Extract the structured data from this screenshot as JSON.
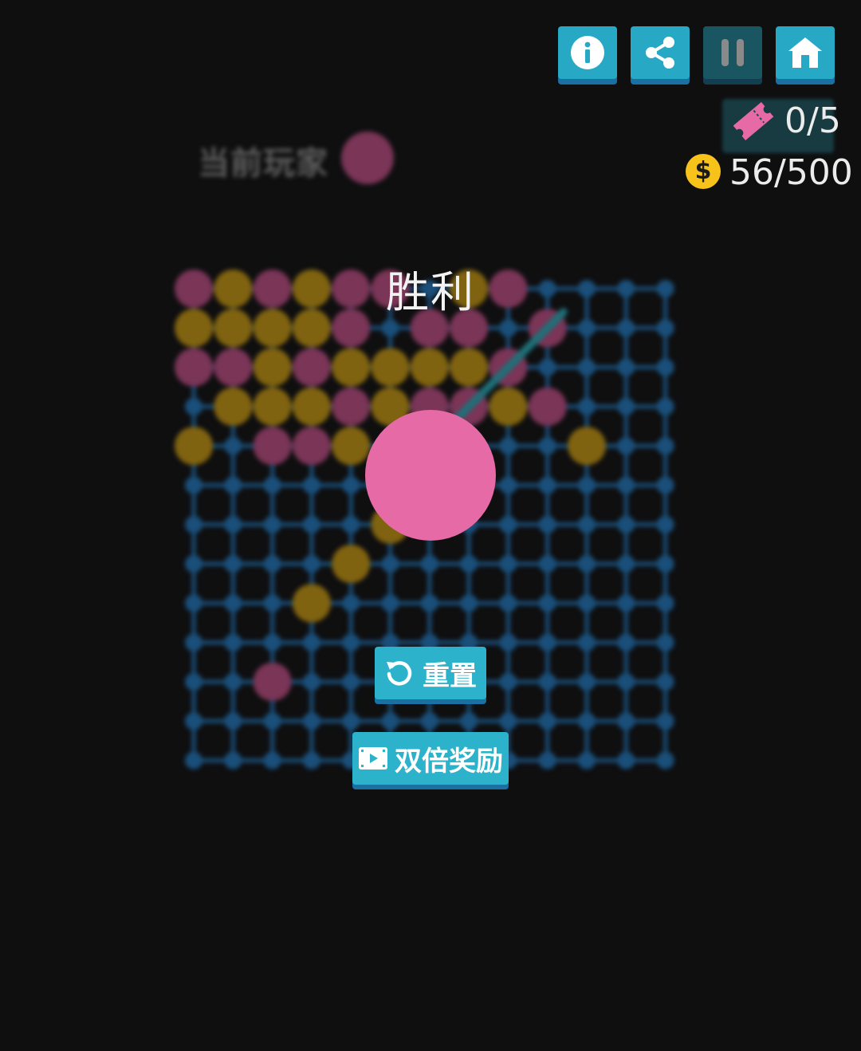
{
  "header": {
    "buttons": [
      {
        "name": "info-button",
        "icon": "info-icon"
      },
      {
        "name": "share-button",
        "icon": "share-icon"
      },
      {
        "name": "pause-button",
        "icon": "pause-icon"
      },
      {
        "name": "home-button",
        "icon": "home-icon"
      }
    ],
    "tickets": {
      "icon": "ticket-icon",
      "value": "0/5",
      "color": "#e66aa6"
    },
    "coins": {
      "icon": "coin-icon",
      "symbol": "$",
      "value": "56/500",
      "color": "#f7c21a"
    }
  },
  "status": {
    "current_player_label": "当前玩家",
    "current_player_color": "#7a3557"
  },
  "board": {
    "size": 13,
    "colors": {
      "grid": "#1a4f7a",
      "pink": "#7a3557",
      "gold": "#806310",
      "win_line": "#1f6f78"
    },
    "pink_stones": [
      [
        0,
        0
      ],
      [
        0,
        2
      ],
      [
        0,
        4
      ],
      [
        0,
        5
      ],
      [
        0,
        8
      ],
      [
        1,
        4
      ],
      [
        1,
        6
      ],
      [
        1,
        7
      ],
      [
        1,
        9
      ],
      [
        2,
        0
      ],
      [
        2,
        1
      ],
      [
        2,
        3
      ],
      [
        2,
        8
      ],
      [
        3,
        4
      ],
      [
        3,
        6
      ],
      [
        3,
        7
      ],
      [
        3,
        9
      ],
      [
        4,
        2
      ],
      [
        4,
        3
      ],
      [
        10,
        2
      ]
    ],
    "gold_stones": [
      [
        0,
        1
      ],
      [
        0,
        3
      ],
      [
        0,
        7
      ],
      [
        1,
        0
      ],
      [
        1,
        1
      ],
      [
        1,
        2
      ],
      [
        1,
        3
      ],
      [
        2,
        2
      ],
      [
        2,
        4
      ],
      [
        2,
        5
      ],
      [
        2,
        6
      ],
      [
        2,
        7
      ],
      [
        3,
        1
      ],
      [
        3,
        2
      ],
      [
        3,
        3
      ],
      [
        3,
        5
      ],
      [
        3,
        8
      ],
      [
        4,
        0
      ],
      [
        4,
        4
      ],
      [
        4,
        10
      ],
      [
        6,
        5
      ],
      [
        7,
        4
      ],
      [
        8,
        3
      ]
    ],
    "win_line": [
      [
        1,
        9
      ],
      [
        3,
        7
      ]
    ]
  },
  "result": {
    "title": "胜利",
    "winner_color": "#e66aa6"
  },
  "buttons": {
    "reset": {
      "label": "重置",
      "icon": "reset-icon"
    },
    "double_reward": {
      "label": "双倍奖励",
      "icon": "video-icon"
    }
  }
}
